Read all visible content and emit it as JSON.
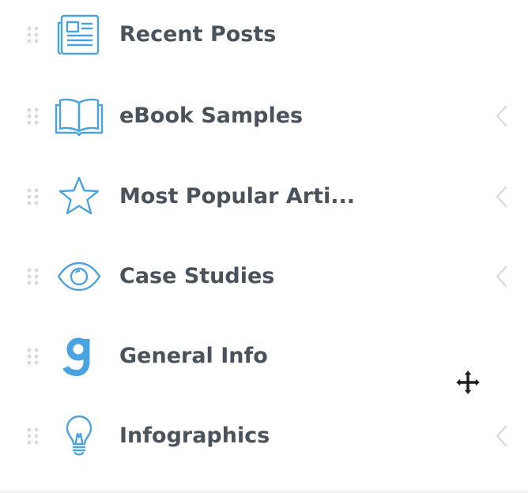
{
  "theme": {
    "icon_color": "#4aa3df",
    "label_color": "#4a525b",
    "handle_color": "#d9d9d9",
    "chevron_color": "#dddddd"
  },
  "menu": {
    "items": [
      {
        "label": "Recent Posts",
        "icon": "newspaper-icon",
        "has_submenu": false
      },
      {
        "label": "eBook Samples",
        "icon": "open-book-icon",
        "has_submenu": true
      },
      {
        "label": "Most Popular Arti...",
        "icon": "star-icon",
        "has_submenu": true
      },
      {
        "label": "Case Studies",
        "icon": "eye-icon",
        "has_submenu": true
      },
      {
        "label": "General Info",
        "icon": "letter-g-icon",
        "has_submenu": false
      },
      {
        "label": "Infographics",
        "icon": "lightbulb-icon",
        "has_submenu": true
      }
    ]
  },
  "cursor": {
    "type": "move-cursor"
  }
}
